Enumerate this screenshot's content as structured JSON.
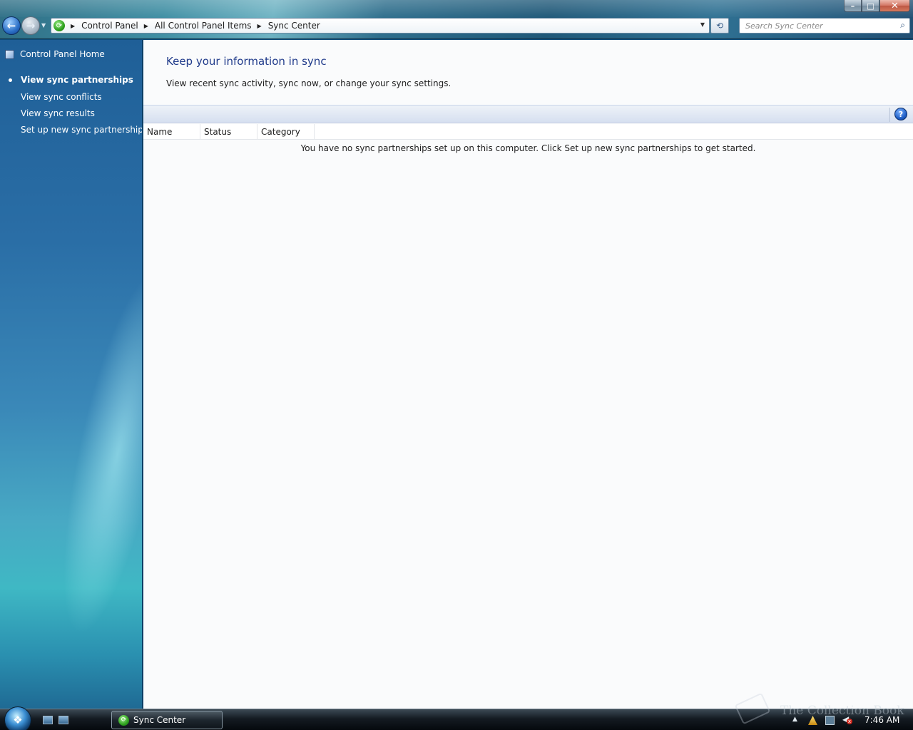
{
  "window": {
    "controls": {
      "minimize": "–",
      "maximize": "□",
      "close": "✕"
    }
  },
  "nav": {
    "back_glyph": "←",
    "forward_glyph": "→",
    "dropdown_glyph": "▼",
    "refresh_glyph": "⟲",
    "breadcrumb": [
      "Control Panel",
      "All Control Panel Items",
      "Sync Center"
    ],
    "breadcrumb_icon": "sync-center-icon"
  },
  "search": {
    "placeholder": "Search Sync Center",
    "value": "",
    "icon": "search-icon"
  },
  "sidebar": {
    "home": "Control Panel Home",
    "tasks": [
      {
        "label": "View sync partnerships",
        "active": true
      },
      {
        "label": "View sync conflicts",
        "active": false
      },
      {
        "label": "View sync results",
        "active": false
      },
      {
        "label": "Set up new sync partnerships",
        "active": false
      }
    ]
  },
  "main": {
    "title": "Keep your information in sync",
    "description": "View recent sync activity, sync now, or change your sync settings.",
    "help_glyph": "?",
    "columns": [
      "Name",
      "Status",
      "Category"
    ],
    "empty_message": "You have no sync partnerships set up on this computer. Click Set up new sync partnerships to get started."
  },
  "taskbar": {
    "start_glyph": "❖",
    "active_task": "Sync Center",
    "watermark": "The Collection Book",
    "tray_up_glyph": "▲",
    "volume_glyph": "◀",
    "volume_muted_glyph": "x",
    "clock": "7:46 AM"
  },
  "colors": {
    "sidebar_top": "#1f5f97",
    "title_blue": "#1f3a8a",
    "main_bg": "#fafbfc"
  }
}
